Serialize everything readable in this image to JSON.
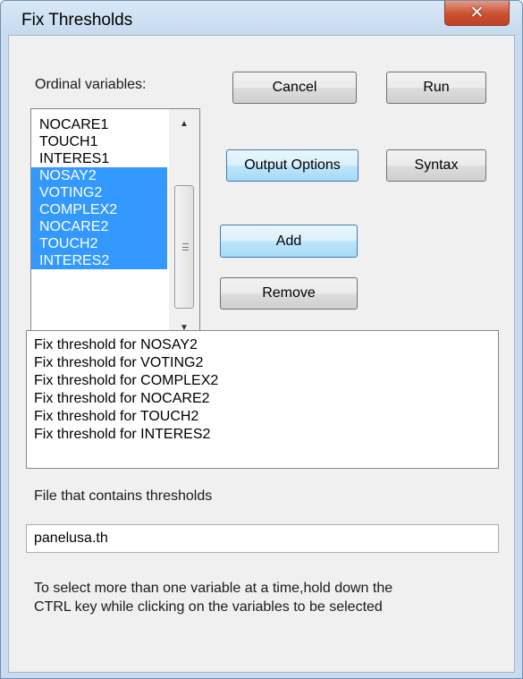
{
  "window": {
    "title": "Fix Thresholds",
    "close_icon": "close-icon"
  },
  "variables_label": "Ordinal variables:",
  "variables": [
    {
      "name": "NOCARE1",
      "selected": false
    },
    {
      "name": "TOUCH1",
      "selected": false
    },
    {
      "name": "INTERES1",
      "selected": false
    },
    {
      "name": "NOSAY2",
      "selected": true
    },
    {
      "name": "VOTING2",
      "selected": true
    },
    {
      "name": "COMPLEX2",
      "selected": true
    },
    {
      "name": "NOCARE2",
      "selected": true
    },
    {
      "name": "TOUCH2",
      "selected": true
    },
    {
      "name": "INTERES2",
      "selected": true
    }
  ],
  "buttons": {
    "cancel": "Cancel",
    "run": "Run",
    "output_options": "Output Options",
    "syntax": "Syntax",
    "add": "Add",
    "remove": "Remove"
  },
  "thresholds_list": [
    "Fix threshold for NOSAY2",
    "Fix threshold for VOTING2",
    "Fix threshold for COMPLEX2",
    "Fix threshold for NOCARE2",
    "Fix threshold for TOUCH2",
    "Fix threshold for INTERES2"
  ],
  "file_label": "File that contains thresholds",
  "file_value": "panelusa.th",
  "hint": {
    "line1": "To select more than one variable at a time,hold down the",
    "line2": "CTRL key while clicking on the variables to be selected"
  },
  "colors": {
    "selection": "#3399ff",
    "close_button": "#c9502f",
    "title_bar": "#c6daee"
  }
}
